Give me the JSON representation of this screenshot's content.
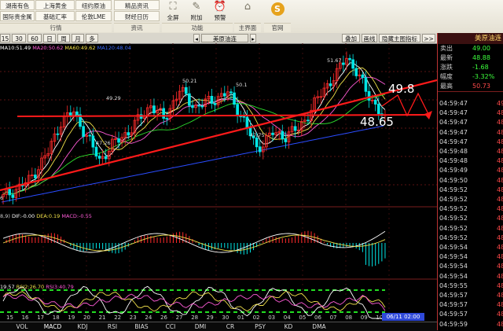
{
  "toolbar": {
    "markets_row1": [
      "湖南有色",
      "上海黄金",
      "纽约原油"
    ],
    "markets_row2": [
      "国际贵金属",
      "基础汇率",
      "伦敦LME"
    ],
    "news_row1": "精品资讯",
    "news_row2": "财经日历",
    "sections": {
      "market": "行情",
      "info": "资讯",
      "function": "功能",
      "home": "主界面",
      "website": "官网"
    },
    "buttons": {
      "fullscreen": "全屏",
      "attach": "附加",
      "alert": "预警"
    }
  },
  "periods": [
    "15",
    "30",
    "60",
    "日",
    "周",
    "月",
    "多"
  ],
  "chart_title": "美原油连",
  "right_buttons": [
    "叠加",
    "画线",
    "隐藏主图指标",
    ">>"
  ],
  "ma_legend": {
    "ma10": "MA10:51.49",
    "ma20": "MA20:50.62",
    "ma60": "MA60:49.62",
    "ma120": "MA120:48.04"
  },
  "macd_legend": {
    "params": "8,9)",
    "dif": "DIF:-0.00",
    "dea": "DEA:0.19",
    "macd": "MACD:-0.55"
  },
  "rsi_legend": {
    "rsi1": "19.57",
    "rsi2": "RSI2:26.70",
    "rsi3": "RSI3:40.79"
  },
  "price_labels": [
    "51.67",
    "50.21",
    "50.1",
    "49.29",
    "47.26",
    "47.75",
    "6"
  ],
  "annotations": {
    "upper": "49.8",
    "lower": "48.65"
  },
  "x_axis": [
    "15",
    "16",
    "17",
    "18",
    "19",
    "20",
    "21",
    "22",
    "23",
    "24",
    "26",
    "27",
    "28",
    "29",
    "30",
    "01",
    "02",
    "03",
    "04",
    "05",
    "06",
    "07",
    "08",
    "09",
    "10"
  ],
  "x_cursor_label": "06/11 02:00",
  "indicator_tabs": [
    "VOL",
    "MACD",
    "KDJ",
    "RSI",
    "BIAS",
    "CCI",
    "DMI",
    "CR",
    "PSY",
    "KD",
    "DMA"
  ],
  "panel": {
    "title": "美原油连",
    "quotes": [
      {
        "label": "卖出",
        "value": "49.00",
        "color": "#3dff3d"
      },
      {
        "label": "最新",
        "value": "48.88",
        "color": "#3dff3d"
      },
      {
        "label": "涨跌",
        "value": "-1.68",
        "color": "#3dff3d"
      },
      {
        "label": "幅度",
        "value": "-3.32%",
        "color": "#3dff3d"
      },
      {
        "label": "最高",
        "value": "50.73",
        "color": "#ff4a4a"
      }
    ],
    "ticks": [
      {
        "time": "04:59:47",
        "p": "49"
      },
      {
        "time": "04:59:47",
        "p": "48"
      },
      {
        "time": "04:59:47",
        "p": "48"
      },
      {
        "time": "04:59:47",
        "p": "48"
      },
      {
        "time": "04:59:47",
        "p": "48"
      },
      {
        "time": "04:59:48",
        "p": "48"
      },
      {
        "time": "04:59:48",
        "p": "48"
      },
      {
        "time": "04:59:49",
        "p": "48"
      },
      {
        "time": "04:59:50",
        "p": "48"
      },
      {
        "time": "04:59:52",
        "p": "48"
      },
      {
        "time": "04:59:52",
        "p": "48"
      },
      {
        "time": "04:59:52",
        "p": "48"
      },
      {
        "time": "04:59:52",
        "p": "48"
      },
      {
        "time": "04:59:52",
        "p": "48"
      },
      {
        "time": "04:59:52",
        "p": "48"
      },
      {
        "time": "04:59:54",
        "p": "48"
      },
      {
        "time": "04:59:54",
        "p": "48"
      },
      {
        "time": "04:59:54",
        "p": "48"
      },
      {
        "time": "04:59:54",
        "p": "48"
      },
      {
        "time": "04:59:55",
        "p": "48"
      },
      {
        "time": "04:59:57",
        "p": "48"
      },
      {
        "time": "04:59:57",
        "p": "48"
      },
      {
        "time": "04:59:57",
        "p": "48"
      },
      {
        "time": "04:59:59",
        "p": "48"
      }
    ]
  },
  "colors": {
    "bull": "#ff2a2a",
    "bear": "#00e5e5",
    "trendline": "#ff1a1a",
    "support": "#ff1a1a",
    "rsi_band": "#22dd22"
  }
}
